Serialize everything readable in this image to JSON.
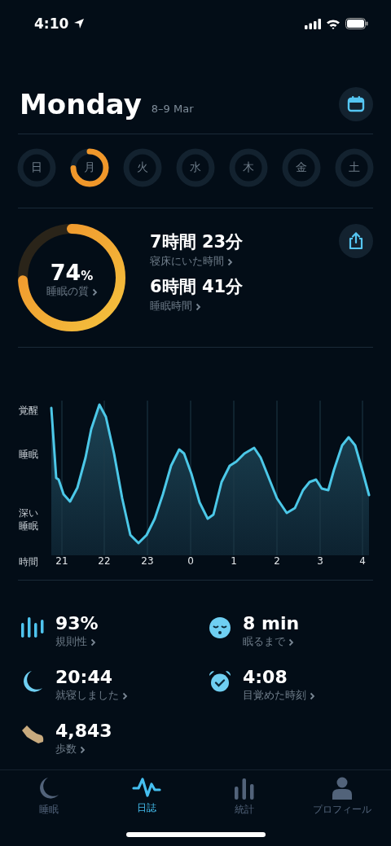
{
  "status_bar": {
    "time": "4:10"
  },
  "header": {
    "title": "Monday",
    "date_range": "8–9 Mar"
  },
  "days": [
    {
      "label": "日",
      "kind": "empty"
    },
    {
      "label": "月",
      "kind": "scored"
    },
    {
      "label": "火",
      "kind": "empty"
    },
    {
      "label": "水",
      "kind": "empty"
    },
    {
      "label": "木",
      "kind": "empty"
    },
    {
      "label": "金",
      "kind": "empty"
    },
    {
      "label": "土",
      "kind": "empty"
    }
  ],
  "summary": {
    "quality": {
      "value": "74",
      "unit": "%",
      "label": "睡眠の質"
    },
    "metrics": [
      {
        "value": "7時間 23分",
        "label": "寝床にいた時間"
      },
      {
        "value": "6時間 41分",
        "label": "睡眠時間"
      }
    ]
  },
  "sleep_chart": {
    "y_labels": [
      "覚醒",
      "睡眠",
      "深い睡眠"
    ],
    "x_title": "時間",
    "x_labels": [
      "21",
      "22",
      "23",
      "0",
      "1",
      "2",
      "3",
      "4"
    ]
  },
  "stats": [
    {
      "kind": "regularity",
      "value": "93%",
      "label": "規則性"
    },
    {
      "kind": "fall_asleep",
      "value": "8 min",
      "label": "眠るまで"
    },
    {
      "kind": "bedtime",
      "value": "20:44",
      "label": "就寝しました"
    },
    {
      "kind": "wake",
      "value": "4:08",
      "label": "目覚めた時刻"
    },
    {
      "kind": "steps",
      "value": "4,843",
      "label": "歩数"
    }
  ],
  "tab_bar": [
    {
      "kind": "sleep",
      "label": "睡眠",
      "selected": false
    },
    {
      "kind": "journal",
      "label": "日誌",
      "selected": true
    },
    {
      "kind": "stats",
      "label": "統計",
      "selected": false
    },
    {
      "kind": "profile",
      "label": "プロフィール",
      "selected": false
    }
  ]
}
